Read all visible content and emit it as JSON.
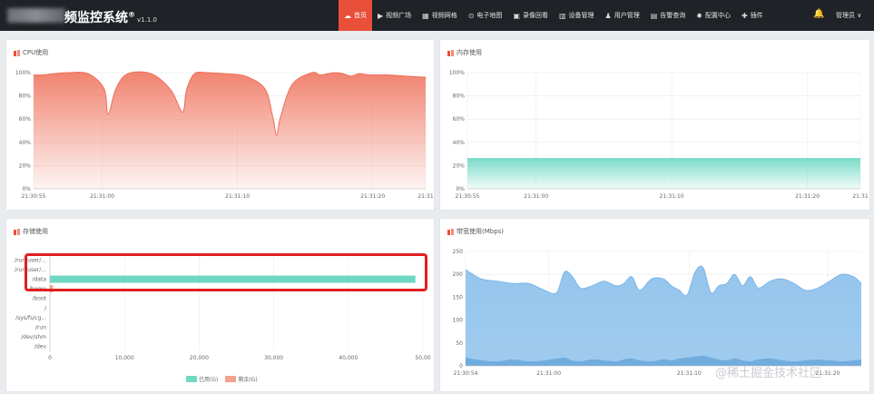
{
  "header": {
    "title": "频监控系统",
    "trademark": "®",
    "version": "v1.1.0",
    "nav": [
      {
        "label": "首页",
        "icon": "cloud-icon",
        "active": true
      },
      {
        "label": "视频广场",
        "icon": "play-icon"
      },
      {
        "label": "视频网格",
        "icon": "grid-icon"
      },
      {
        "label": "电子地图",
        "icon": "map-pin-icon"
      },
      {
        "label": "录像回看",
        "icon": "camera-icon"
      },
      {
        "label": "设备管理",
        "icon": "device-icon"
      },
      {
        "label": "用户管理",
        "icon": "user-icon"
      },
      {
        "label": "告警查询",
        "icon": "alarm-icon"
      },
      {
        "label": "配置中心",
        "icon": "gear-icon"
      },
      {
        "label": "插件",
        "icon": "puzzle-icon"
      }
    ],
    "user_label": "管理员 ∨"
  },
  "panels": {
    "cpu": {
      "title": "CPU使用"
    },
    "memory": {
      "title": "内存使用"
    },
    "storage": {
      "title": "存储使用",
      "legend": [
        "已用(G)",
        "剩余(G)"
      ]
    },
    "bandwidth": {
      "title": "带宽使用(Mbps)"
    }
  },
  "watermark": "@稀土掘金技术社区",
  "colors": {
    "accent": "#e8503a",
    "cpu": "#f07c68",
    "memory": "#6fd8c4",
    "storage_used": "#6fd8c4",
    "storage_free": "#f2a28e",
    "bandwidth": "#8fc2ec",
    "bandwidth_dark": "#6aa8dc"
  },
  "chart_data": [
    {
      "type": "area",
      "title": "CPU使用",
      "x_ticks": [
        "21:30:55",
        "21:31:00",
        "21:31:10",
        "21:31:20",
        "21:31"
      ],
      "y_ticks": [
        "0%",
        "20%",
        "40%",
        "60%",
        "80%",
        "100%"
      ],
      "ylim": [
        0,
        100
      ],
      "x": [
        0,
        2,
        5,
        9,
        14,
        18,
        19,
        21,
        24,
        30,
        35,
        38,
        39,
        41,
        44,
        49,
        54,
        59,
        61,
        62,
        63,
        66,
        71,
        73,
        75,
        77,
        79,
        81,
        83,
        86,
        90,
        95,
        100
      ],
      "values": [
        98,
        98,
        99,
        100,
        99,
        86,
        64,
        86,
        99,
        99,
        85,
        66,
        85,
        99,
        100,
        99,
        97,
        86,
        62,
        46,
        62,
        90,
        100,
        98,
        99,
        100,
        99,
        97,
        99,
        98,
        98,
        97,
        96
      ]
    },
    {
      "type": "area",
      "title": "内存使用",
      "x_ticks": [
        "21:30:55",
        "21:31:00",
        "21:31:10",
        "21:31:20",
        "21:31"
      ],
      "y_ticks": [
        "0%",
        "20%",
        "40%",
        "60%",
        "80%",
        "100%"
      ],
      "ylim": [
        0,
        100
      ],
      "x": [
        0,
        100
      ],
      "values": [
        26,
        26
      ]
    },
    {
      "type": "bar",
      "title": "存储使用",
      "orientation": "horizontal",
      "categories": [
        "/run/user/...",
        "/run/user/...",
        "/data",
        "/home",
        "/boot",
        "/",
        "/sys/fs/cg...",
        "/run",
        "/dev/shm",
        "/dev"
      ],
      "series": [
        {
          "name": "已用(G)",
          "values": [
            0,
            0,
            49000,
            0,
            0,
            0,
            0,
            0,
            0,
            0
          ]
        },
        {
          "name": "剩余(G)",
          "values": [
            0,
            0,
            0,
            400,
            0,
            0,
            0,
            0,
            0,
            0
          ]
        }
      ],
      "x_ticks": [
        "0",
        "10,000",
        "20,000",
        "30,000",
        "40,000",
        "50,00"
      ],
      "xlim": [
        0,
        50000
      ]
    },
    {
      "type": "area",
      "title": "带宽使用(Mbps)",
      "x_ticks": [
        "21:30:54",
        "21:31:00",
        "21:31:10",
        "21:31:20"
      ],
      "y_ticks": [
        "0",
        "50",
        "100",
        "150",
        "200",
        "250"
      ],
      "ylim": [
        0,
        250
      ],
      "x": [
        0,
        4,
        8,
        12,
        16,
        20,
        23,
        25,
        27,
        29,
        32,
        35,
        38,
        40,
        42,
        44,
        47,
        50,
        52,
        54,
        56,
        58,
        60,
        62,
        64,
        66,
        68,
        70,
        72,
        74,
        77,
        80,
        83,
        86,
        89,
        92,
        95,
        98,
        100
      ],
      "values": [
        210,
        190,
        185,
        180,
        180,
        165,
        160,
        205,
        195,
        170,
        175,
        185,
        175,
        180,
        195,
        165,
        190,
        190,
        175,
        165,
        155,
        205,
        215,
        160,
        175,
        180,
        200,
        175,
        195,
        170,
        185,
        190,
        180,
        165,
        170,
        185,
        200,
        195,
        180
      ],
      "secondary_values": [
        18,
        12,
        10,
        14,
        10,
        12,
        16,
        18,
        12,
        10,
        14,
        12,
        10,
        14,
        16,
        12,
        10,
        14,
        12,
        16,
        18,
        20,
        22,
        18,
        14,
        12,
        16,
        12,
        10,
        14,
        16,
        12,
        10,
        12,
        14,
        12,
        10,
        12,
        14
      ]
    }
  ]
}
